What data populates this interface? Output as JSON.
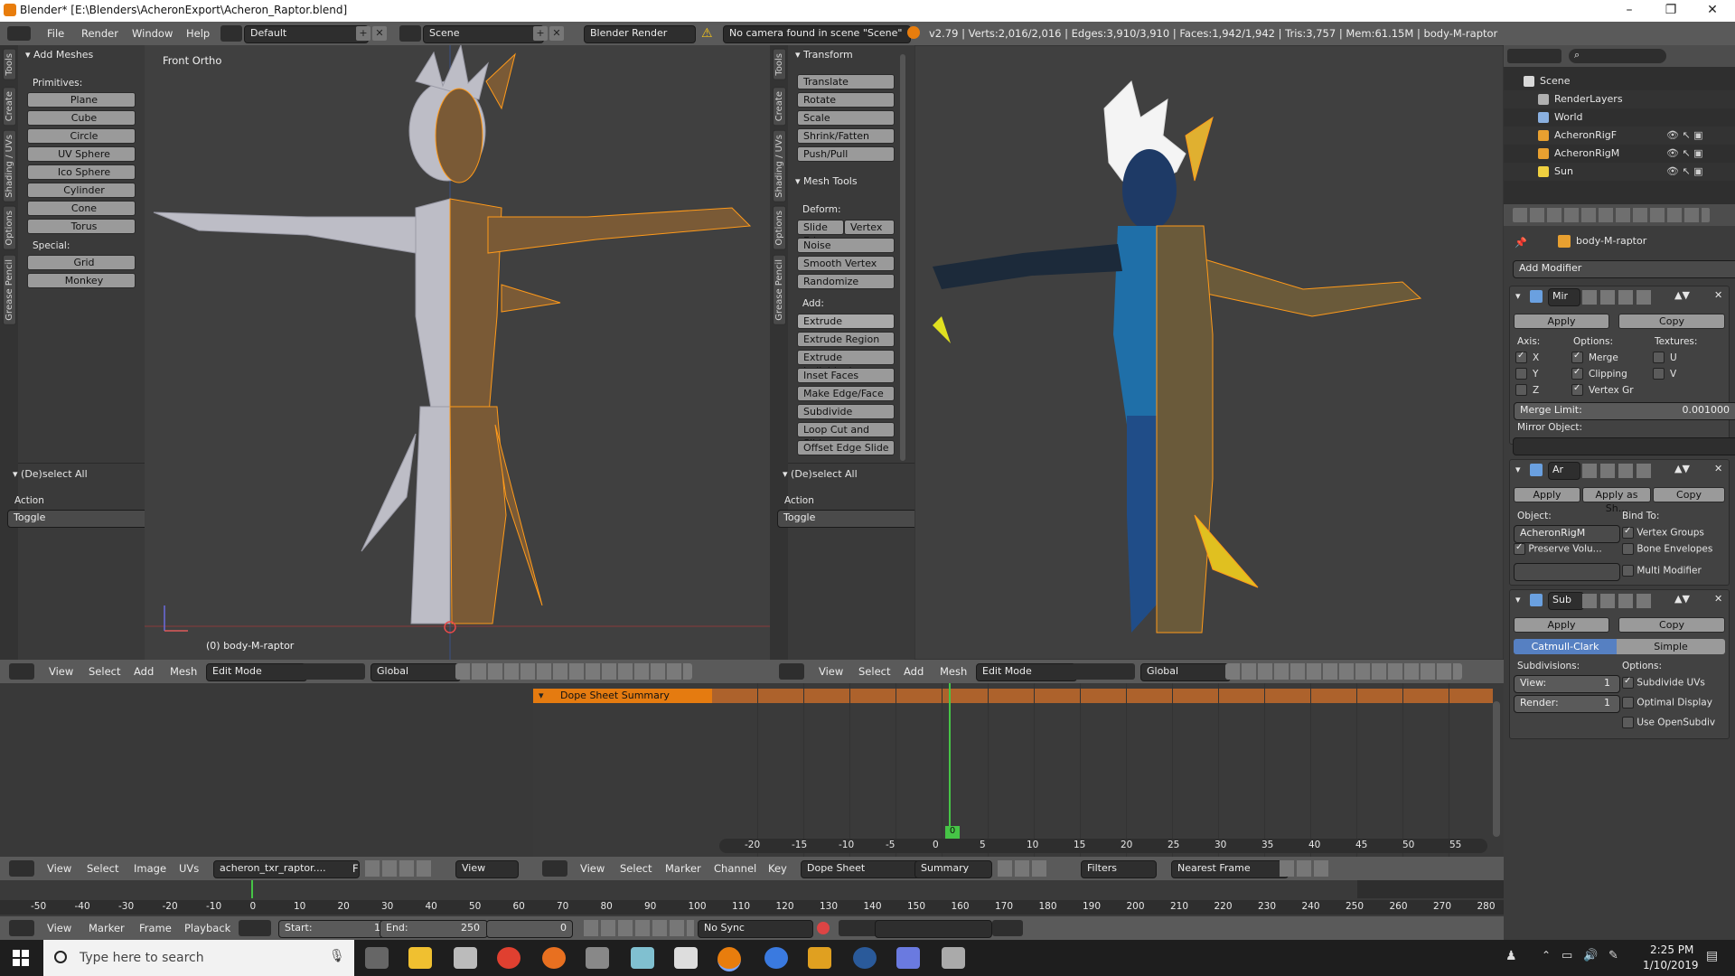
{
  "window": {
    "title": "Blender* [E:\\Blenders\\AcheronExport\\Acheron_Raptor.blend]",
    "controls": [
      "–",
      "❐",
      "✕"
    ]
  },
  "info_header": {
    "menus": [
      "File",
      "Render",
      "Window",
      "Help"
    ],
    "layout": "Default",
    "scene": "Scene",
    "engine": "Blender Render",
    "warning": "No camera found in scene \"Scene\"",
    "stats": "v2.79 | Verts:2,016/2,016 | Edges:3,910/3,910 | Faces:1,942/1,942 | Tris:3,757 | Mem:61.15M | body-M-raptor"
  },
  "left_tools": {
    "tabs": [
      "Tools",
      "Create",
      "Shading / UVs",
      "Options",
      "Grease Pencil"
    ],
    "section": "Add Meshes",
    "primitives_label": "Primitives:",
    "primitives": [
      "Plane",
      "Cube",
      "Circle",
      "UV Sphere",
      "Ico Sphere",
      "Cylinder",
      "Cone",
      "Torus"
    ],
    "special_label": "Special:",
    "special": [
      "Grid",
      "Monkey"
    ],
    "deselect_section": "(De)select All",
    "action_label": "Action",
    "action_value": "Toggle"
  },
  "left_viewport": {
    "view_label": "Front Ortho",
    "object_label": "(0) body-M-raptor",
    "footer": {
      "menus": [
        "View",
        "Select",
        "Add",
        "Mesh"
      ],
      "mode": "Edit Mode",
      "orientation": "Global"
    }
  },
  "mid_tools": {
    "tabs": [
      "Tools",
      "Create",
      "Shading / UVs",
      "Options",
      "Grease Pencil"
    ],
    "transform_section": "Transform",
    "transform": [
      "Translate",
      "Rotate",
      "Scale",
      "Shrink/Fatten",
      "Push/Pull"
    ],
    "mesh_tools_section": "Mesh Tools",
    "deform_label": "Deform:",
    "deform_pair": [
      "Slide Ed",
      "Vertex"
    ],
    "deform": [
      "Noise",
      "Smooth Vertex",
      "Randomize"
    ],
    "add_label": "Add:",
    "extrude": "Extrude",
    "add": [
      "Extrude Region",
      "Extrude Individual",
      "Inset Faces",
      "Make Edge/Face",
      "Subdivide",
      "Loop Cut and Slide",
      "Offset Edge Slide"
    ],
    "deselect_section": "(De)select All",
    "action_label": "Action",
    "action_value": "Toggle"
  },
  "right_viewport": {
    "footer": {
      "menus": [
        "View",
        "Select",
        "Add",
        "Mesh"
      ],
      "mode": "Edit Mode",
      "orientation": "Global"
    }
  },
  "outliner": {
    "items": [
      {
        "label": "Scene",
        "icon": "scene-icon"
      },
      {
        "label": "RenderLayers",
        "icon": "renderlayers-icon"
      },
      {
        "label": "World",
        "icon": "world-icon"
      },
      {
        "label": "AcheronRigF",
        "icon": "armature-icon"
      },
      {
        "label": "AcheronRigM",
        "icon": "armature-icon"
      },
      {
        "label": "Sun",
        "icon": "lamp-icon"
      }
    ]
  },
  "properties": {
    "object_name": "body-M-raptor",
    "add_modifier": "Add Modifier",
    "mirror": {
      "name": "Mir",
      "apply": "Apply",
      "copy": "Copy",
      "axis_label": "Axis:",
      "options_label": "Options:",
      "textures_label": "Textures:",
      "axes": [
        {
          "label": "X",
          "checked": true
        },
        {
          "label": "Y",
          "checked": false
        },
        {
          "label": "Z",
          "checked": false
        }
      ],
      "options": [
        {
          "label": "Merge",
          "checked": true
        },
        {
          "label": "Clipping",
          "checked": true
        },
        {
          "label": "Vertex Gr",
          "checked": true
        }
      ],
      "textures": [
        {
          "label": "U",
          "checked": false
        },
        {
          "label": "V",
          "checked": false
        }
      ],
      "merge_limit_label": "Merge Limit:",
      "merge_limit_value": "0.001000",
      "mirror_object_label": "Mirror Object:"
    },
    "armature": {
      "name": "Ar",
      "apply": "Apply",
      "apply_as": "Apply as Sh...",
      "copy": "Copy",
      "object_label": "Object:",
      "object_value": "AcheronRigM",
      "bind_label": "Bind To:",
      "preserve": "Preserve Volu...",
      "vertex_groups": "Vertex Groups",
      "bone_envelopes": "Bone Envelopes",
      "multi_modifier": "Multi Modifier"
    },
    "subsurf": {
      "name": "Sub",
      "apply": "Apply",
      "copy": "Copy",
      "catmull": "Catmull-Clark",
      "simple": "Simple",
      "subdivisions_label": "Subdivisions:",
      "options_label": "Options:",
      "view_label": "View:",
      "view_value": "1",
      "render_label": "Render:",
      "render_value": "1",
      "subdivide_uvs": "Subdivide UVs",
      "optimal_display": "Optimal Display",
      "use_opensubdiv": "Use OpenSubdiv"
    }
  },
  "uv_editor": {
    "menus": [
      "View",
      "Select",
      "Image",
      "UVs"
    ],
    "image": "acheron_txr_raptor....",
    "f_label": "F",
    "view_select": "View"
  },
  "dope_sheet": {
    "summary_row": "Dope Sheet Summary",
    "frame_marker": "0",
    "ruler": [
      "-20",
      "-15",
      "-10",
      "-5",
      "0",
      "5",
      "10",
      "15",
      "20",
      "25",
      "30",
      "35",
      "40",
      "45",
      "50",
      "55"
    ],
    "menus": [
      "View",
      "Select",
      "Marker",
      "Channel",
      "Key"
    ],
    "mode": "Dope Sheet",
    "summary": "Summary",
    "filters": "Filters",
    "snap": "Nearest Frame"
  },
  "timeline": {
    "ruler": [
      "-50",
      "-40",
      "-30",
      "-20",
      "-10",
      "0",
      "10",
      "20",
      "30",
      "40",
      "50",
      "60",
      "70",
      "80",
      "90",
      "100",
      "110",
      "120",
      "130",
      "140",
      "150",
      "160",
      "170",
      "180",
      "190",
      "200",
      "210",
      "220",
      "230",
      "240",
      "250",
      "260",
      "270",
      "280"
    ],
    "menus": [
      "View",
      "Marker",
      "Frame",
      "Playback"
    ],
    "start_label": "Start:",
    "start_value": "1",
    "end_label": "End:",
    "end_value": "250",
    "current": "0",
    "sync": "No Sync"
  },
  "taskbar": {
    "search_placeholder": "Type here to search",
    "time": "2:25 PM",
    "date": "1/10/2019"
  }
}
